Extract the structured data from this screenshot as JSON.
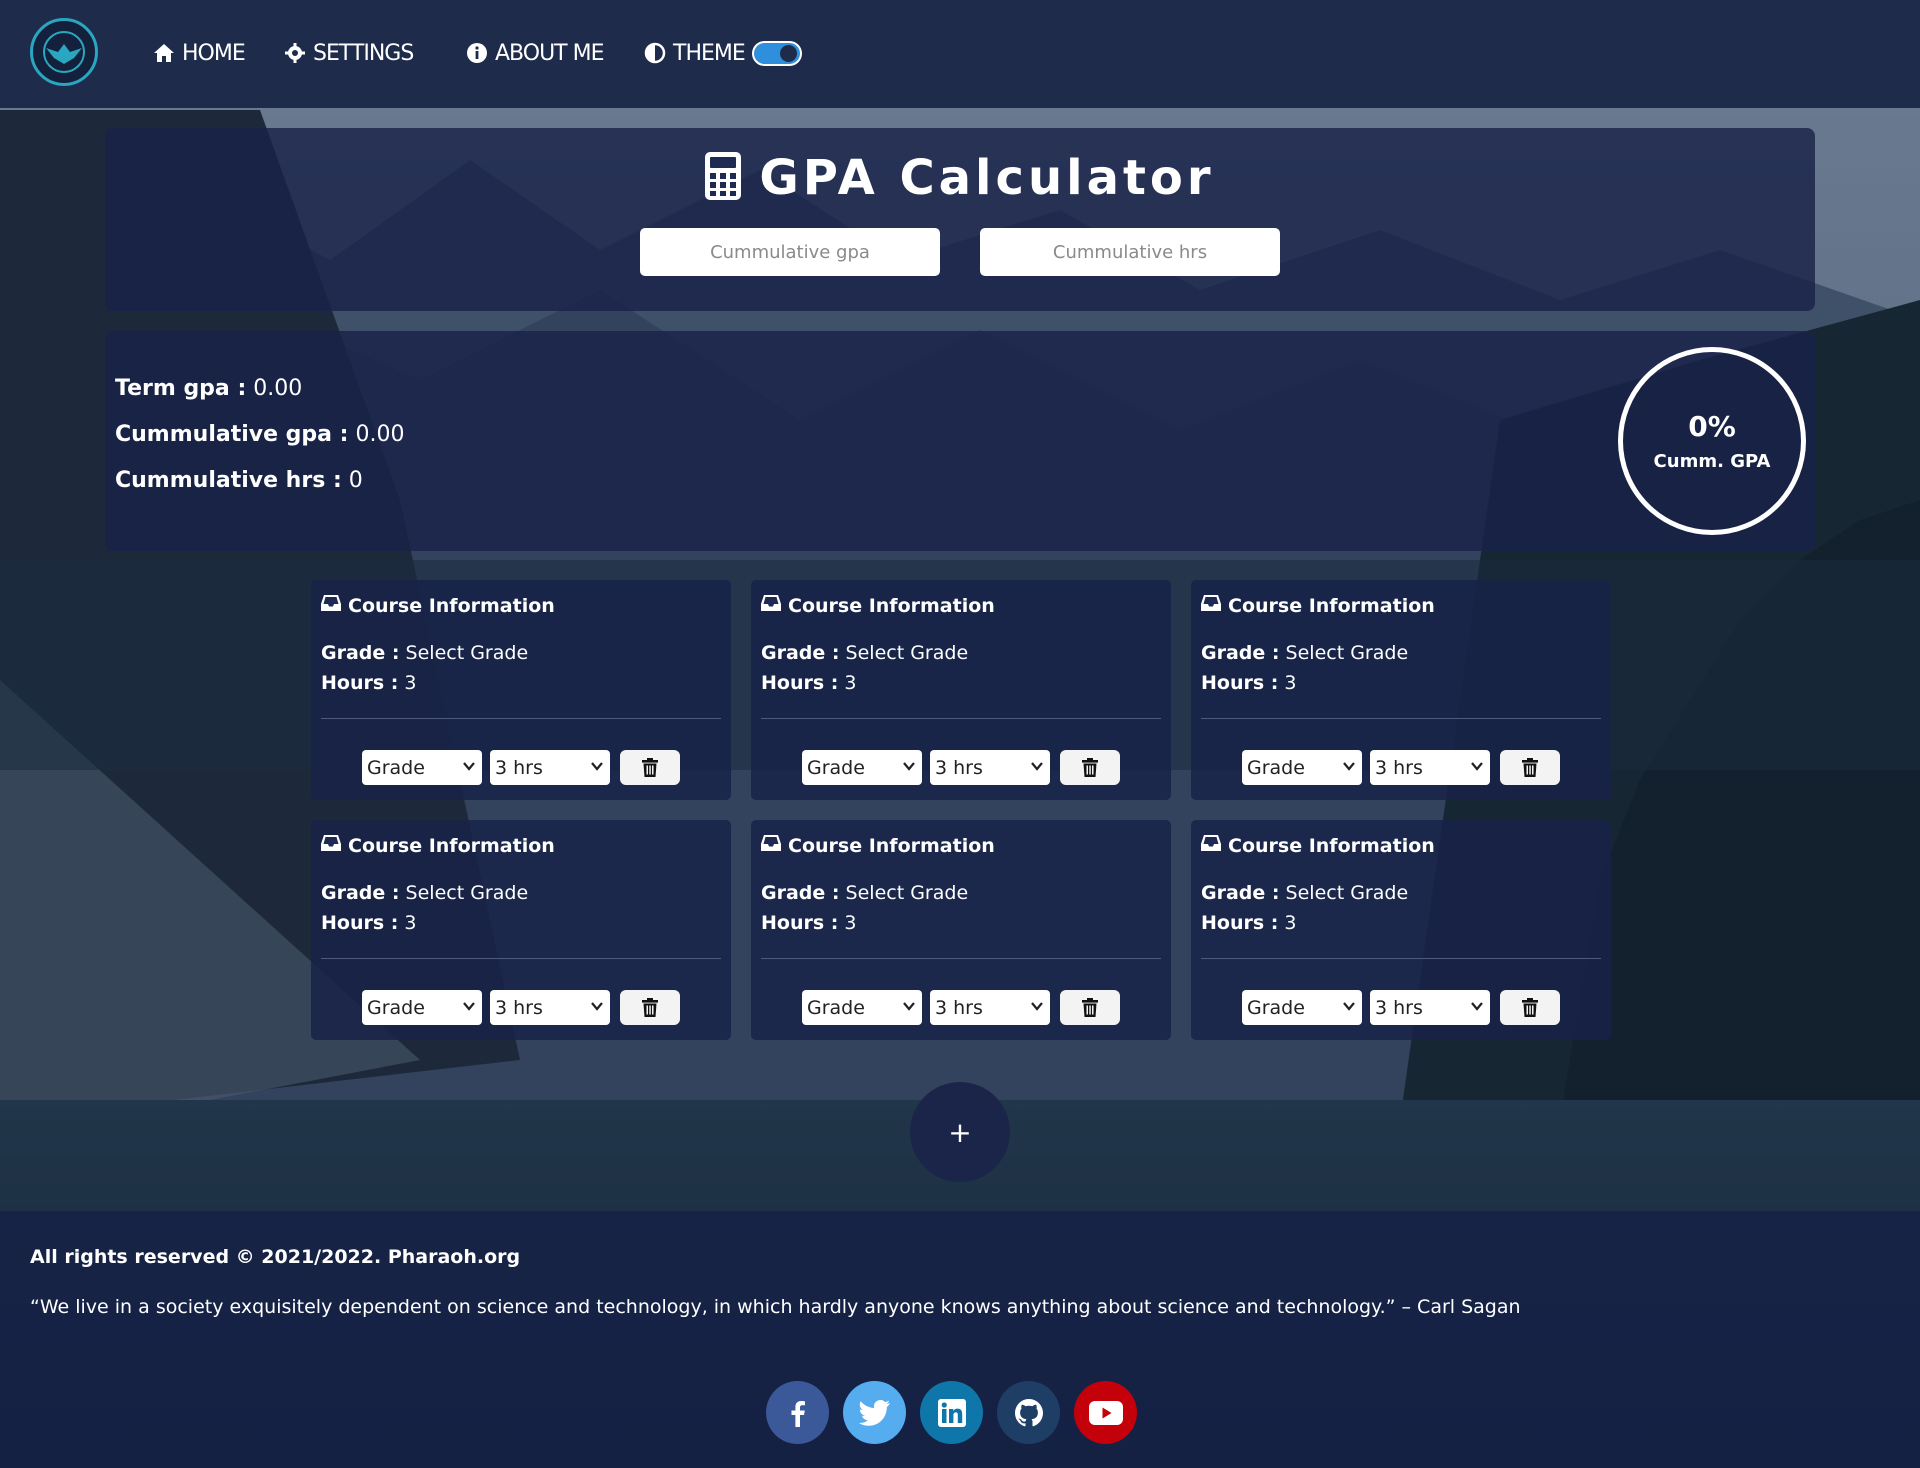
{
  "nav": {
    "items": [
      {
        "label": "HOME",
        "icon": "home-icon"
      },
      {
        "label": "SETTINGS",
        "icon": "gear-icon"
      },
      {
        "label": "ABOUT ME",
        "icon": "info-icon"
      },
      {
        "label": "THEME",
        "icon": "contrast-icon"
      }
    ],
    "theme_toggle_on": true
  },
  "header": {
    "title": "GPA Calculator",
    "title_icon": "calculator-icon",
    "cumulative_gpa_placeholder": "Cummulative gpa",
    "cumulative_hrs_placeholder": "Cummulative hrs"
  },
  "stats": {
    "term_gpa_label": "Term gpa :",
    "term_gpa_value": "0.00",
    "cum_gpa_label": "Cummulative gpa :",
    "cum_gpa_value": "0.00",
    "cum_hrs_label": "Cummulative hrs :",
    "cum_hrs_value": "0",
    "gauge_percent": "0%",
    "gauge_label": "Cumm. GPA"
  },
  "course_card": {
    "title": "Course Information",
    "grade_label": "Grade :",
    "hours_label": "Hours :"
  },
  "courses": [
    {
      "grade": "Select Grade",
      "hours": "3",
      "grade_select": "Grade",
      "hours_select": "3 hrs"
    },
    {
      "grade": "Select Grade",
      "hours": "3",
      "grade_select": "Grade",
      "hours_select": "3 hrs"
    },
    {
      "grade": "Select Grade",
      "hours": "3",
      "grade_select": "Grade",
      "hours_select": "3 hrs"
    },
    {
      "grade": "Select Grade",
      "hours": "3",
      "grade_select": "Grade",
      "hours_select": "3 hrs"
    },
    {
      "grade": "Select Grade",
      "hours": "3",
      "grade_select": "Grade",
      "hours_select": "3 hrs"
    },
    {
      "grade": "Select Grade",
      "hours": "3",
      "grade_select": "Grade",
      "hours_select": "3 hrs"
    }
  ],
  "add_button": "+",
  "footer": {
    "copyright": "All rights reserved © 2021/2022. Pharaoh.org",
    "quote": "“We live in a society exquisitely dependent on science and technology, in which hardly anyone knows anything about science and technology.” – Carl Sagan",
    "socials": [
      {
        "name": "facebook-icon",
        "color": "#3b5998"
      },
      {
        "name": "twitter-icon",
        "color": "#55acee"
      },
      {
        "name": "linkedin-icon",
        "color": "#0e76a8"
      },
      {
        "name": "github-icon",
        "color": "#1f3e66"
      },
      {
        "name": "youtube-icon",
        "color": "#c4000a"
      }
    ]
  },
  "colors": {
    "navbar": "#1f2b4b",
    "panel": "#182248",
    "accent": "#2f8fdd"
  }
}
